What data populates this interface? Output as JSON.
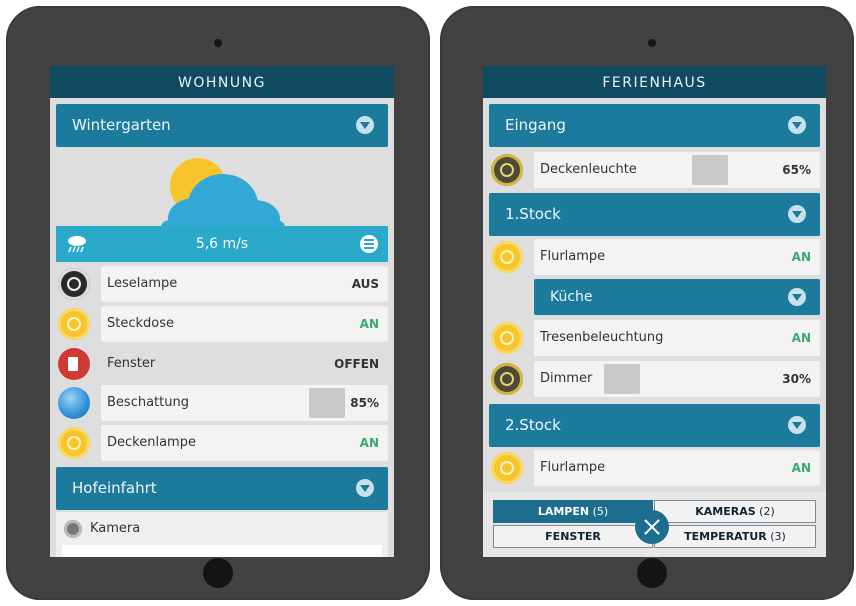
{
  "left": {
    "title": "WOHNUNG",
    "section1": "Wintergarten",
    "wind": "5,6 m/s",
    "devices": [
      {
        "label": "Leselampe",
        "value": "AUS"
      },
      {
        "label": "Steckdose",
        "value": "AN"
      },
      {
        "label": "Fenster",
        "value": "OFFEN"
      },
      {
        "label": "Beschattung",
        "value": "85%"
      },
      {
        "label": "Deckenlampe",
        "value": "AN"
      }
    ],
    "section2": "Hofeinfahrt",
    "camera": "Kamera"
  },
  "right": {
    "title": "FERIENHAUS",
    "sections": [
      "Eingang",
      "1.Stock",
      "Küche",
      "2.Stock"
    ],
    "devices": [
      {
        "label": "Deckenleuchte",
        "value": "65%"
      },
      {
        "label": "Flurlampe",
        "value": "AN"
      },
      {
        "label": "Tresenbeleuchtung",
        "value": "AN"
      },
      {
        "label": "Dimmer",
        "value": "30%"
      },
      {
        "label": "Flurlampe",
        "value": "AN"
      }
    ],
    "tabs": [
      {
        "label": "LAMPEN",
        "count": "(5)"
      },
      {
        "label": "KAMERAS",
        "count": "(2)"
      },
      {
        "label": "FENSTER",
        "count": ""
      },
      {
        "label": "TEMPERATUR",
        "count": "(3)"
      }
    ]
  },
  "colors": {
    "accent": "#1c7b9c",
    "title_bar": "#0f4a61",
    "on": "#3aa870",
    "sun": "#f7c52a"
  }
}
